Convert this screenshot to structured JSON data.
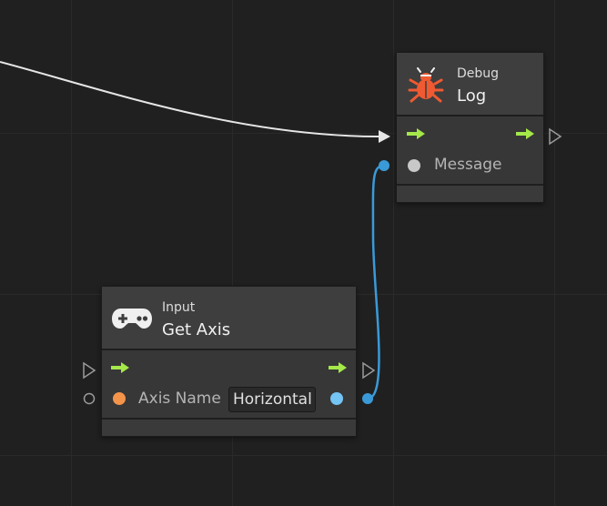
{
  "debug_log_node": {
    "category": "Debug",
    "title": "Log",
    "icon": "bug-icon",
    "icon_color": "#f05a32",
    "ports": {
      "message_label": "Message"
    }
  },
  "get_axis_node": {
    "category": "Input",
    "title": "Get Axis",
    "icon": "gamepad-icon",
    "ports": {
      "axis_name_label": "Axis Name",
      "axis_name_value": "Horizontal"
    }
  },
  "colors": {
    "flow_arrow": "#a4e84a",
    "axis_name_port": "#f4944a",
    "float_port": "#74c4f4",
    "float_wire": "#3a9ad8",
    "message_port": "#c8c8c8",
    "flow_wire": "#e6e6e6"
  }
}
